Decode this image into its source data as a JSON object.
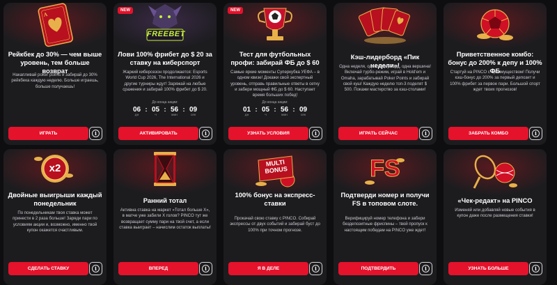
{
  "colors": {
    "accent": "#e4122b",
    "card_bg": "#1c1c1f",
    "page_bg": "#0e0e10"
  },
  "cards": [
    {
      "title": "Рейкбек до 30% — чем выше уровень, тем больше возврат",
      "desc": "Накапливай poker points и забирай до 30% рейкбека каждую неделю. Больше играешь, больше получаешь!",
      "button": "ИГРАТЬ",
      "art_icon": "ace-of-hearts-card-icon"
    },
    {
      "badge": "NEW",
      "title": "Лови 100% фрибет до $ 20 за ставку на киберспорт",
      "desc": "Жаркий киберсезон продолжается: Esports World Cup 2026, The International 2026 и другие турниры ждут! Заряжай на любые сражения и забирай 100% фрибет до $ 20.",
      "timer_label": "До конца акции:",
      "timer": [
        {
          "value": "06",
          "unit": "дн"
        },
        {
          "value": "05",
          "unit": "ч"
        },
        {
          "value": "56",
          "unit": "мин"
        },
        {
          "value": "09",
          "unit": "сек"
        }
      ],
      "button": "АКТИВИРОВАТЬ",
      "art_text": "FREEBET",
      "art_icon": "freebet-dragon-icon"
    },
    {
      "badge": "NEW",
      "title": "Тест для футбольных профи: забирай ФБ до $ 60",
      "desc": "Самые яркие моменты Суперкубка УЕФА – в одном квизе! Докажи свой экспертный уровень, отправь правильные ответы в сетку и забери мощный ФБ до $ 60. Наступает время больших побед!",
      "timer_label": "До конца акции:",
      "timer": [
        {
          "value": "01",
          "unit": "дн"
        },
        {
          "value": "05",
          "unit": "ч"
        },
        {
          "value": "56",
          "unit": "мин"
        },
        {
          "value": "09",
          "unit": "сек"
        }
      ],
      "button": "УЗНАТЬ УСЛОВИЯ",
      "art_icon": "cup-with-ball-icon"
    },
    {
      "title": "Кэш-лидерборд «Пик недели»!",
      "desc": "Одна неделя, один лидерборд, одна вершина! Включай турбо-режим, играй в Hold'em и Omaha, зарабатывай Poker Points и забирай свой куш! Каждую неделю топ-3 поделят $ 500. Покажи мастерство за кэш-столами!",
      "button": "ИГРАТЬ СЕЙЧАС",
      "art_icon": "playing-cards-fan-icon"
    },
    {
      "title": "Приветственное комбо: бонус до 200% к депу и 100% ФБ",
      "desc": "Стартуй на PINCO с преимуществом! Получи кэш-бонус до 200% за первый депозит и 100% фрибет за первое пари. Большой спорт ждет твоих прогнозов!",
      "button": "ЗАБРАТЬ КОМБО",
      "art_icon": "football-coins-icon"
    },
    {
      "title": "Двойные выигрыши каждый понедельник",
      "desc": "По понедельникам твоя ставка может принести в 2 раза больше! Заряди пари по условиям акции и, возможно, именно твой купон окажется счастливым.",
      "button": "СДЕЛАТЬ СТАВКУ",
      "art_text": "x2",
      "art_icon": "x2-coin-icon"
    },
    {
      "title": "Ранний тотал",
      "desc": "Активна ставка на маркет «Тотал больше X», в матче уже забили X голов? PINCO тут же возвращает сумму пари на твой счет, а если ставка выиграет – начислим остаток выплаты!",
      "button": "ВПЕРЕД",
      "art_icon": "hourglass-icon"
    },
    {
      "title": "100% бонус на экспресс-ставки",
      "desc": "Прокачай свою ставку с PINCO. Собирай экспрессы от двух событий и забирай буст до 100% при точном прогнозе.",
      "button": "Я В ДЕЛЕ",
      "art_text": "MULTI BONUS",
      "art_icon": "multi-bonus-icon"
    },
    {
      "title": "Подтверди номер и получи FS в топовом слоте.",
      "desc": "Верифицируй номер телефона и забери бездепозитные фриспины – твой пропуск к настоящим победам на PINCO уже ждет!",
      "button": "ПОДТВЕРДИТЬ",
      "art_text": "FS",
      "art_icon": "fs-letters-icon"
    },
    {
      "title": "«Чек-редакт» на PINCO",
      "desc": "Изменяй или добавляй новые события в купон даже после размещения ставки!",
      "button": "УЗНАТЬ БОЛЬШЕ",
      "art_icon": "sports-balls-icon"
    }
  ]
}
